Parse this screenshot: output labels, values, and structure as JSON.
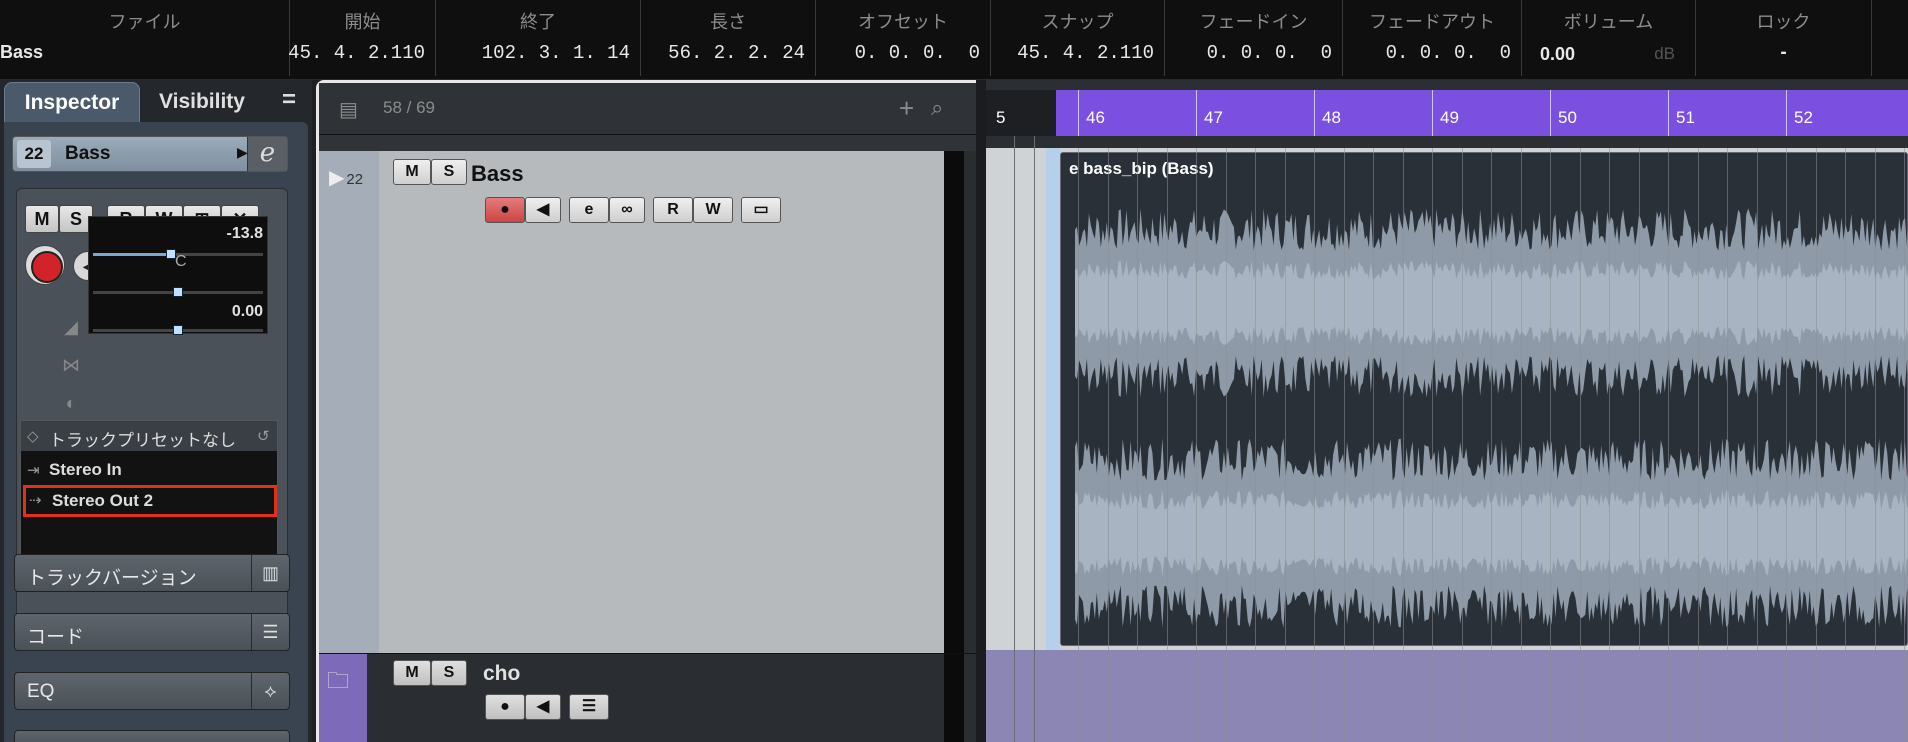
{
  "infoline": {
    "columns": [
      {
        "header": "ファイル",
        "value": "Bass"
      },
      {
        "header": "開始",
        "value": "45. 4. 2.110"
      },
      {
        "header": "終了",
        "value": "102. 3. 1. 14"
      },
      {
        "header": "長さ",
        "value": "56. 2. 2. 24"
      },
      {
        "header": "オフセット",
        "value": "0. 0. 0.  0"
      },
      {
        "header": "スナップ",
        "value": "45. 4. 2.110"
      },
      {
        "header": "フェードイン",
        "value": "0. 0. 0.  0"
      },
      {
        "header": "フェードアウト",
        "value": "0. 0. 0.  0"
      },
      {
        "header": "ボリューム",
        "value": "0.00",
        "unit": "dB"
      },
      {
        "header": "ロック",
        "value": "-"
      }
    ]
  },
  "inspector": {
    "tabs": {
      "inspector": "Inspector",
      "visibility": "Visibility"
    },
    "menu_glyph": "=",
    "track": {
      "number": "22",
      "name": "Bass"
    },
    "buttons": {
      "mute": "M",
      "solo": "S",
      "read": "R",
      "write": "W"
    },
    "fader": {
      "volume": "-13.8",
      "pan_center": "C",
      "pan_value": "0.00",
      "volume_level": 0.46
    },
    "preset": "トラックプリセットなし",
    "input": "Stereo In",
    "output": "Stereo Out 2",
    "sections": [
      "トラックバージョン",
      "コード",
      "EQ"
    ]
  },
  "tracklist": {
    "count": "58 / 69",
    "tracks": [
      {
        "number": "22",
        "name": "Bass"
      },
      {
        "name": "cho"
      }
    ]
  },
  "arrange": {
    "ruler_start": "5",
    "bars": [
      "46",
      "47",
      "48",
      "49",
      "50",
      "51",
      "52"
    ],
    "event_title": "e bass_bip (Bass)",
    "colors": {
      "ruler": "#7b4fe0",
      "folder": "#7d6ab8",
      "waveform": "#8e9aa8"
    }
  }
}
